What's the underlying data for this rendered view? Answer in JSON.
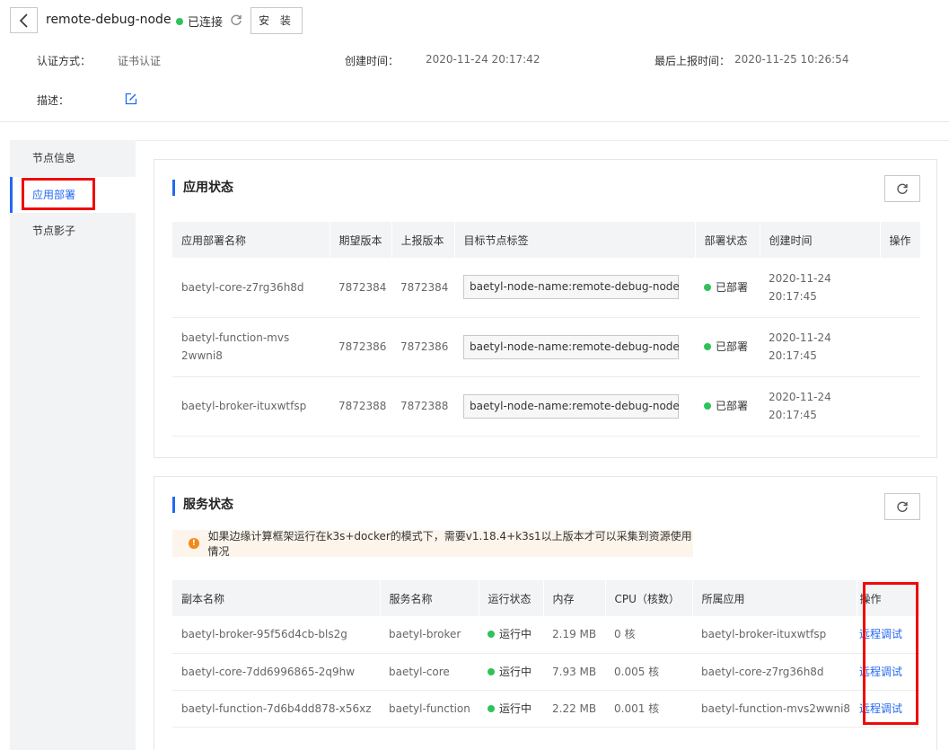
{
  "header": {
    "node_name": "remote-debug-node",
    "status": "已连接",
    "install_label": "安 装",
    "auth_label": "认证方式：",
    "auth_value": "证书认证",
    "created_label": "创建时间：",
    "created_value": "2020-11-24 20:17:42",
    "last_report_label": "最后上报时间：",
    "last_report_value": "2020-11-25 10:26:54",
    "desc_label": "描述："
  },
  "sidebar": {
    "items": [
      {
        "label": "节点信息"
      },
      {
        "label": "应用部署"
      },
      {
        "label": "节点影子"
      }
    ]
  },
  "app_status": {
    "title": "应用状态",
    "columns": [
      "应用部署名称",
      "期望版本",
      "上报版本",
      "目标节点标签",
      "部署状态",
      "创建时间",
      "操作"
    ],
    "rows": [
      {
        "name": "baetyl-core-z7rg36h8d",
        "expected": "7872384",
        "reported": "7872384",
        "label": "baetyl-node-name:remote-debug-node",
        "status": "已部署",
        "created_date": "2020-11-24",
        "created_time": "20:17:45"
      },
      {
        "name": "baetyl-function-mvs2wwni8",
        "expected": "7872386",
        "reported": "7872386",
        "label": "baetyl-node-name:remote-debug-node",
        "status": "已部署",
        "created_date": "2020-11-24",
        "created_time": "20:17:45"
      },
      {
        "name": "baetyl-broker-ituxwtfsp",
        "expected": "7872388",
        "reported": "7872388",
        "label": "baetyl-node-name:remote-debug-node",
        "status": "已部署",
        "created_date": "2020-11-24",
        "created_time": "20:17:45"
      }
    ]
  },
  "service_status": {
    "title": "服务状态",
    "notice": "如果边缘计算框架运行在k3s+docker的模式下，需要v1.18.4+k3s1以上版本才可以采集到资源使用情况",
    "columns": [
      "副本名称",
      "服务名称",
      "运行状态",
      "内存",
      "CPU（核数）",
      "所属应用",
      "操作"
    ],
    "rows": [
      {
        "replica": "baetyl-broker-95f56d4cb-bls2g",
        "service": "baetyl-broker",
        "status": "运行中",
        "memory": "2.19 MB",
        "cpu": "0 核",
        "app": "baetyl-broker-ituxwtfsp",
        "action": "远程调试"
      },
      {
        "replica": "baetyl-core-7dd6996865-2q9hw",
        "service": "baetyl-core",
        "status": "运行中",
        "memory": "7.93 MB",
        "cpu": "0.005 核",
        "app": "baetyl-core-z7rg36h8d",
        "action": "远程调试"
      },
      {
        "replica": "baetyl-function-7d6b4dd878-x56xz",
        "service": "baetyl-function",
        "status": "运行中",
        "memory": "2.22 MB",
        "cpu": "0.001 核",
        "app": "baetyl-function-mvs2wwni8",
        "action": "远程调试"
      }
    ]
  },
  "colors": {
    "accent": "#2468f2",
    "success": "#2fc25b",
    "highlight": "#ee0a0a",
    "warning": "#f38a1a"
  }
}
